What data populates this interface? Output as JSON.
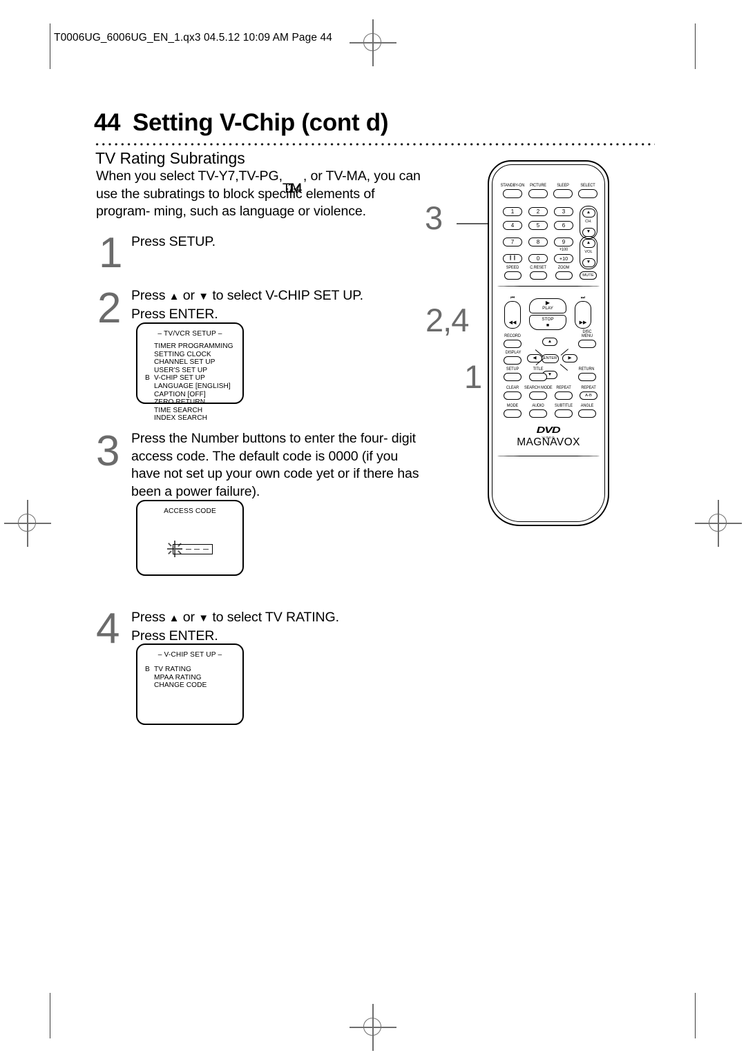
{
  "page_header": "T0006UG_6006UG_EN_1.qx3  04.5.12  10:09 AM  Page 44",
  "title": {
    "number": "44",
    "text": "Setting V-Chip (cont d)"
  },
  "subhead": "TV Rating Subratings",
  "intro": {
    "line1_a": "When you select TV-Y7,TV-PG,",
    "line1_overlap_a": "TM",
    "line1_overlap_b": "14",
    "line1_b": ", or TV-MA, you can",
    "line2": "use the subratings to block specific elements of program-",
    "line3": "ming, such as language or violence."
  },
  "steps": [
    {
      "number": "1",
      "lines": [
        "Press SETUP."
      ]
    },
    {
      "number": "2",
      "line_pre": "Press ",
      "arrow_up": "▲",
      "line_mid": " or ",
      "arrow_down": "▼",
      "line_post": " to select V-CHIP SET UP.",
      "line2": "Press ENTER."
    },
    {
      "number": "3",
      "lines": [
        "Press the Number buttons to enter the four-",
        "digit access code. The default code is 0000 (if you",
        "have not set up your own code yet or if there has",
        "been a power failure)."
      ]
    },
    {
      "number": "4",
      "line_pre": "Press ",
      "arrow_up": "▲",
      "line_mid": " or ",
      "arrow_down": "▼",
      "line_post": " to select TV RATING.",
      "line2": "Press ENTER."
    }
  ],
  "osd_tvvcr": {
    "title": "– TV/VCR SETUP –",
    "cursor": "B",
    "cursor_index": 4,
    "items": [
      "TIMER PROGRAMMING",
      "SETTING CLOCK",
      "CHANNEL SET UP",
      "USER'S SET UP",
      "V-CHIP SET UP",
      "LANGUAGE  [ENGLISH]",
      "CAPTION  [OFF]",
      "ZERO RETURN",
      "TIME SEARCH",
      "INDEX SEARCH"
    ]
  },
  "osd_access": {
    "title": "ACCESS CODE",
    "digits": [
      "–",
      "–",
      "–",
      "–"
    ]
  },
  "osd_vchip": {
    "title": "– V-CHIP SET UP –",
    "cursor": "B",
    "cursor_index": 0,
    "items": [
      "TV RATING",
      "MPAA RATING",
      "CHANGE CODE"
    ]
  },
  "callouts": [
    {
      "label": "3"
    },
    {
      "label": "2,4"
    },
    {
      "label": "1"
    }
  ],
  "remote": {
    "brand": "MAGNAVOX",
    "logo_dvd": "DVD",
    "logo_video": "VIDEO",
    "top_row": [
      "STANDBY-ON",
      "PICTURE",
      "SLEEP",
      "SELECT"
    ],
    "keypad": [
      "1",
      "2",
      "3",
      "4",
      "5",
      "6",
      "7",
      "8",
      "9",
      "❙❙",
      "0",
      "+10"
    ],
    "plus100": "+100",
    "ch_label": "CH.",
    "vol_label": "VOL",
    "arrow_up": "▲",
    "arrow_down": "▼",
    "arrow_left": "◀",
    "arrow_right": "▶",
    "func_row": [
      "SPEED",
      "C.RESET",
      "ZOOM"
    ],
    "mute": "MUTE",
    "transport": {
      "skip_back": "⏮",
      "rew": "◀◀",
      "play_glyph": "▶",
      "play_label": "PLAY",
      "stop_label": "STOP",
      "stop_glyph": "■",
      "ff": "▶▶",
      "skip_fwd": "⏭"
    },
    "record": "RECORD",
    "disc_menu_l1": "DISC",
    "disc_menu_l2": "MENU",
    "display": "DISPLAY",
    "enter": "ENTER",
    "setup": "SETUP",
    "title_btn": "TITLE",
    "return_btn": "RETURN",
    "row_clear": [
      "CLEAR",
      "SEARCH MODE",
      "REPEAT",
      "REPEAT"
    ],
    "repeat_ab": "A-B",
    "row_mode": [
      "MODE",
      "AUDIO",
      "SUBTITLE",
      "ANGLE"
    ]
  }
}
